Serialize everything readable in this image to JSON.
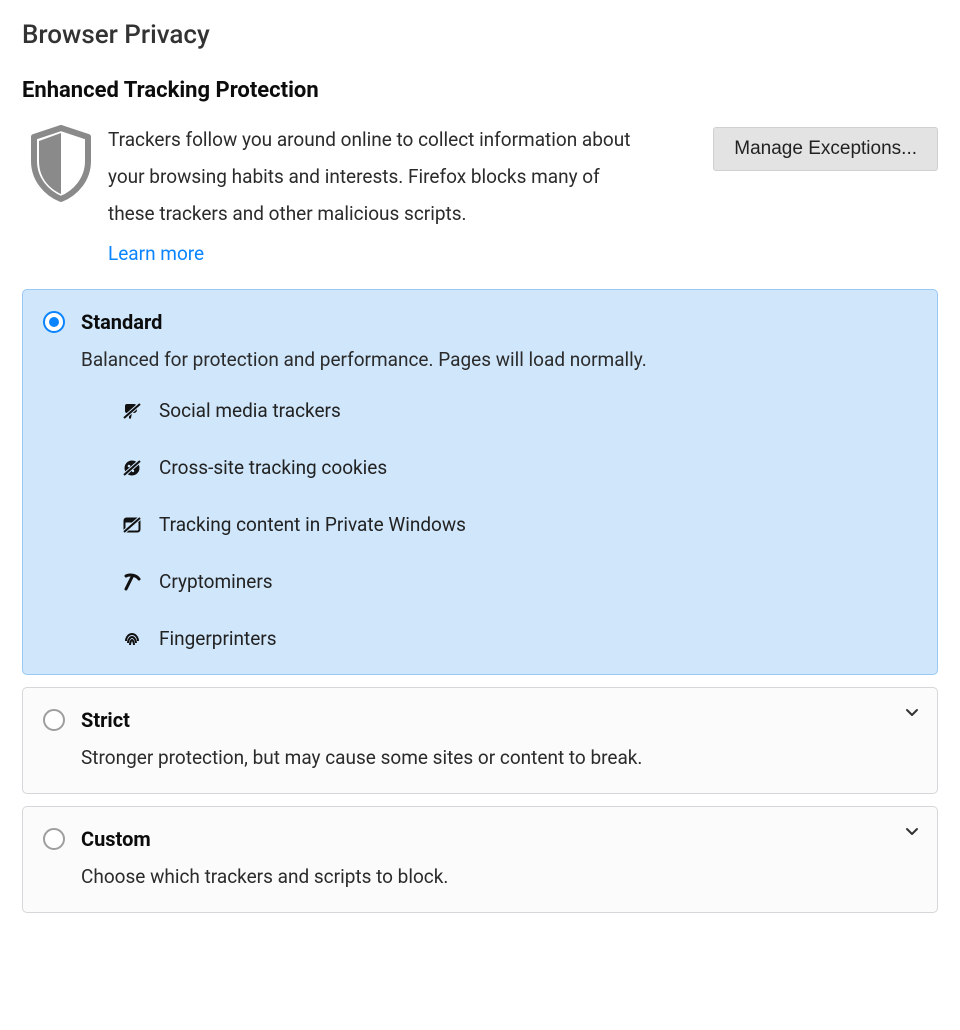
{
  "page_title": "Browser Privacy",
  "section_title": "Enhanced Tracking Protection",
  "intro_text": "Trackers follow you around online to collect information about your browsing habits and interests. Firefox blocks many of these trackers and other malicious scripts.",
  "learn_more": "Learn more",
  "manage_exceptions": "Manage Exceptions...",
  "options": {
    "standard": {
      "title": "Standard",
      "desc": "Balanced for protection and performance. Pages will load normally.",
      "selected": true,
      "items": [
        {
          "label": "Social media trackers",
          "icon": "thumbs-down-slash-icon"
        },
        {
          "label": "Cross-site tracking cookies",
          "icon": "cookie-slash-icon"
        },
        {
          "label": "Tracking content in Private Windows",
          "icon": "window-slash-icon"
        },
        {
          "label": "Cryptominers",
          "icon": "pickaxe-icon"
        },
        {
          "label": "Fingerprinters",
          "icon": "fingerprint-icon"
        }
      ]
    },
    "strict": {
      "title": "Strict",
      "desc": "Stronger protection, but may cause some sites or content to break.",
      "selected": false
    },
    "custom": {
      "title": "Custom",
      "desc": "Choose which trackers and scripts to block.",
      "selected": false
    }
  }
}
